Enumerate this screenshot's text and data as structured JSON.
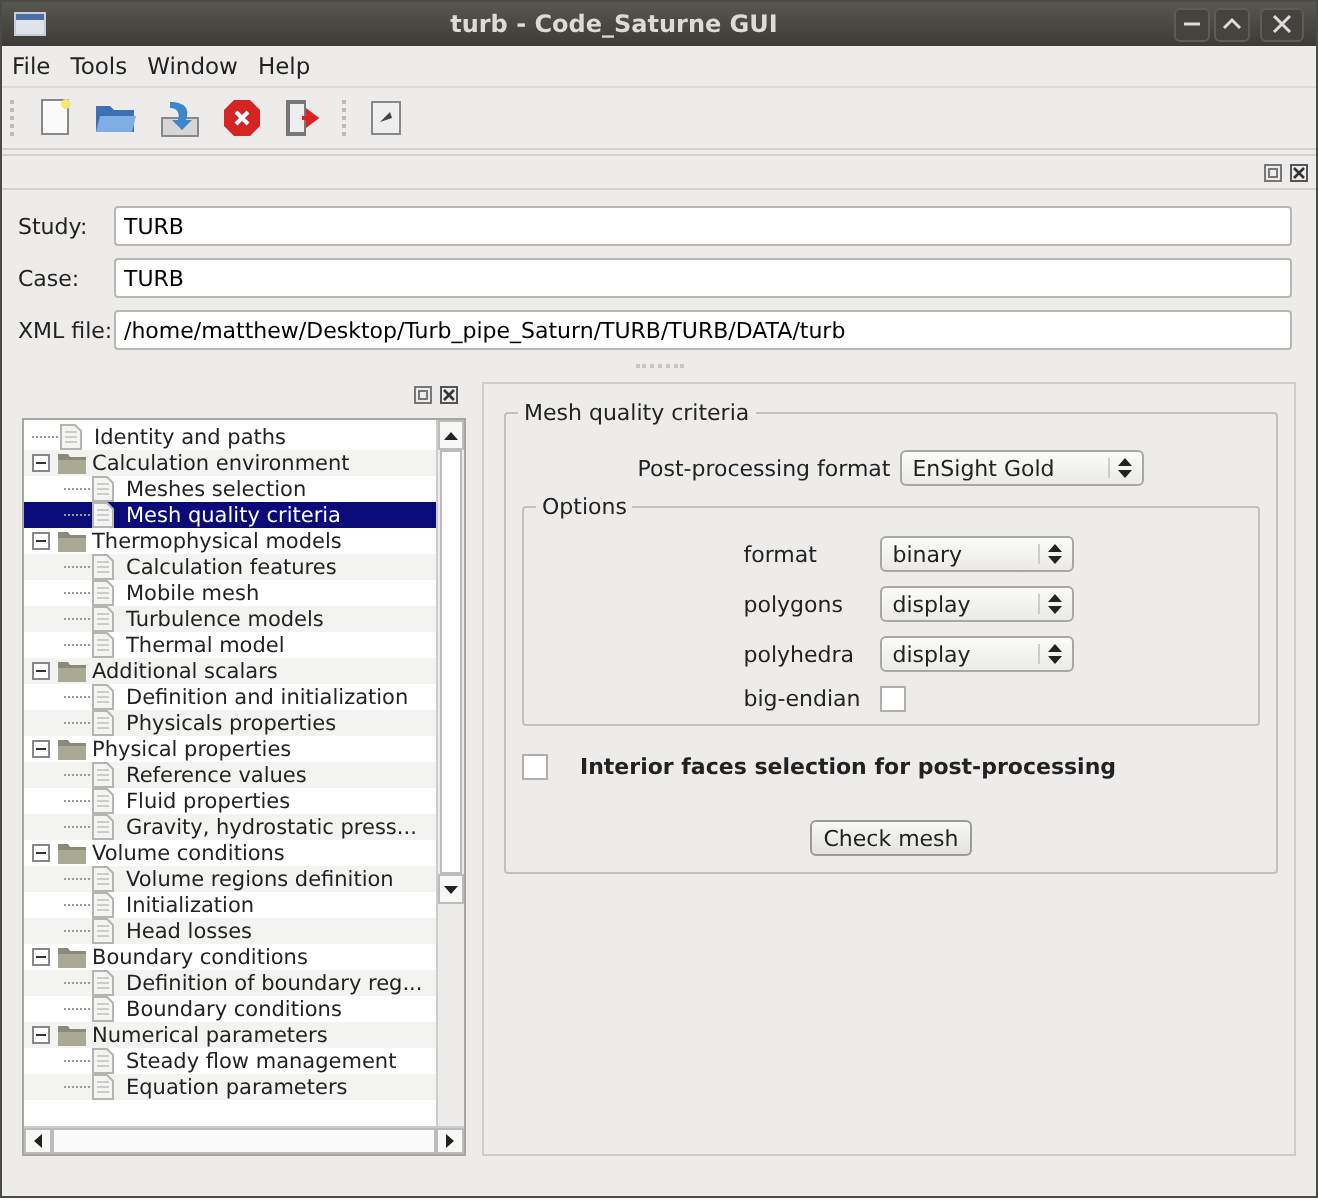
{
  "window": {
    "title": "turb - Code_Saturne GUI"
  },
  "menu": [
    "File",
    "Tools",
    "Window",
    "Help"
  ],
  "identity": {
    "fields": [
      {
        "label": "Study:",
        "value": "TURB"
      },
      {
        "label": "Case:",
        "value": "TURB"
      },
      {
        "label": "XML file:",
        "value": "/home/matthew/Desktop/Turb_pipe_Saturn/TURB/TURB/DATA/turb"
      }
    ]
  },
  "tree": [
    {
      "label": "Identity and paths",
      "kind": "page",
      "selected": false
    },
    {
      "label": "Calculation environment",
      "kind": "folder",
      "expanded": true,
      "selected": false,
      "children": [
        {
          "label": "Meshes selection",
          "kind": "page",
          "selected": false
        },
        {
          "label": "Mesh quality criteria",
          "kind": "page",
          "selected": true
        }
      ]
    },
    {
      "label": "Thermophysical models",
      "kind": "folder",
      "expanded": true,
      "selected": false,
      "children": [
        {
          "label": "Calculation features",
          "kind": "page",
          "selected": false
        },
        {
          "label": "Mobile mesh",
          "kind": "page",
          "selected": false
        },
        {
          "label": "Turbulence models",
          "kind": "page",
          "selected": false
        },
        {
          "label": "Thermal model",
          "kind": "page",
          "selected": false
        }
      ]
    },
    {
      "label": "Additional scalars",
      "kind": "folder",
      "expanded": true,
      "selected": false,
      "children": [
        {
          "label": "Definition and initialization",
          "kind": "page",
          "selected": false
        },
        {
          "label": "Physicals properties",
          "kind": "page",
          "selected": false
        }
      ]
    },
    {
      "label": "Physical properties",
      "kind": "folder",
      "expanded": true,
      "selected": false,
      "children": [
        {
          "label": "Reference values",
          "kind": "page",
          "selected": false
        },
        {
          "label": "Fluid properties",
          "kind": "page",
          "selected": false
        },
        {
          "label": "Gravity, hydrostatic press...",
          "kind": "page",
          "selected": false
        }
      ]
    },
    {
      "label": "Volume conditions",
      "kind": "folder",
      "expanded": true,
      "selected": false,
      "children": [
        {
          "label": "Volume regions definition",
          "kind": "page",
          "selected": false
        },
        {
          "label": "Initialization",
          "kind": "page",
          "selected": false
        },
        {
          "label": "Head losses",
          "kind": "page",
          "selected": false
        }
      ]
    },
    {
      "label": "Boundary conditions",
      "kind": "folder",
      "expanded": true,
      "selected": false,
      "children": [
        {
          "label": "Definition of boundary reg...",
          "kind": "page",
          "selected": false
        },
        {
          "label": "Boundary conditions",
          "kind": "page",
          "selected": false
        }
      ]
    },
    {
      "label": "Numerical parameters",
      "kind": "folder",
      "expanded": true,
      "selected": false,
      "children": [
        {
          "label": "Steady flow management",
          "kind": "page",
          "selected": false
        },
        {
          "label": "Equation parameters",
          "kind": "page",
          "selected": false
        }
      ]
    }
  ],
  "panel": {
    "title": "Mesh quality criteria",
    "postprocessing_format": {
      "label": "Post-processing format",
      "value": "EnSight Gold"
    },
    "options": {
      "title": "Options",
      "selects": [
        {
          "label": "format",
          "value": "binary"
        },
        {
          "label": "polygons",
          "value": "display"
        },
        {
          "label": "polyhedra",
          "value": "display"
        }
      ],
      "big_endian": {
        "label": "big-endian",
        "checked": false
      }
    },
    "interior_faces": {
      "label": "Interior faces selection for post-processing",
      "checked": false
    },
    "button": "Check mesh"
  }
}
